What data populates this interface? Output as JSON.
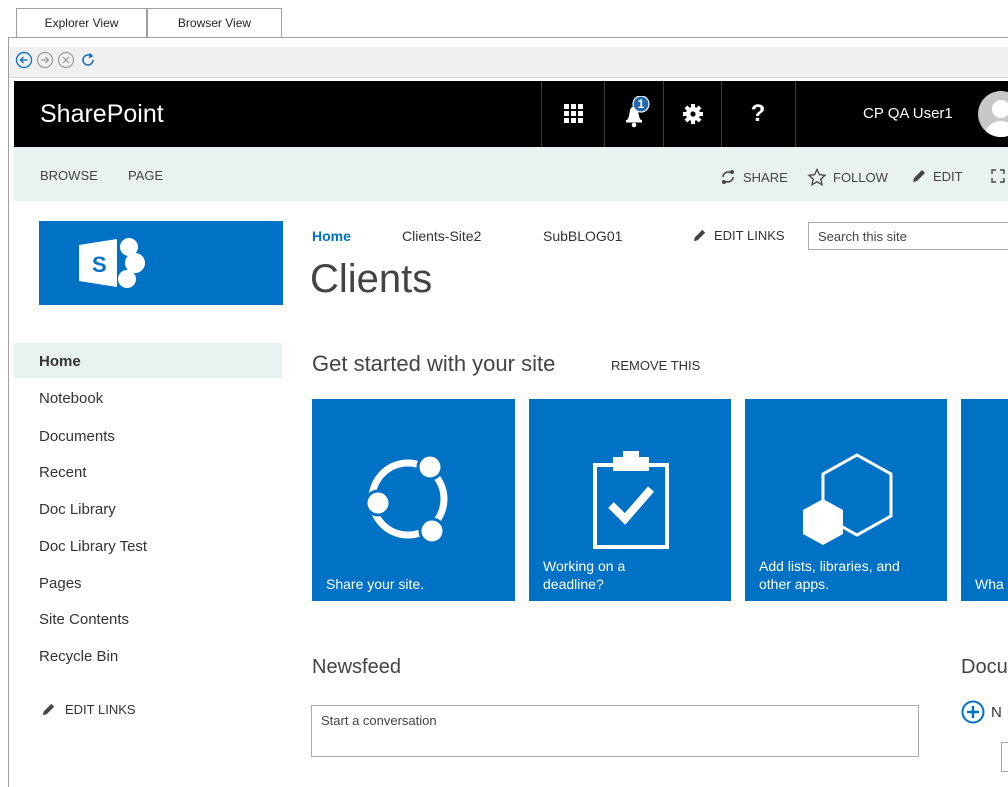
{
  "host_tabs": [
    {
      "label": "Explorer View"
    },
    {
      "label": "Browser View"
    }
  ],
  "suite_bar": {
    "brand": "SharePoint",
    "notification_count": "1",
    "help_symbol": "?",
    "user_name": "CP QA User1"
  },
  "ribbon": {
    "tabs": [
      "BROWSE",
      "PAGE"
    ],
    "actions": {
      "share": "SHARE",
      "follow": "FOLLOW",
      "edit": "EDIT"
    }
  },
  "top_nav": {
    "items": [
      "Home",
      "Clients-Site2",
      "SubBLOG01"
    ],
    "edit_links": "EDIT LINKS",
    "search_placeholder": "Search this site"
  },
  "site_title": "Clients",
  "quick_launch": {
    "items": [
      "Home",
      "Notebook",
      "Documents",
      "Recent",
      "Doc Library",
      "Doc Library Test",
      "Pages",
      "Site Contents",
      "Recycle Bin"
    ],
    "edit_links": "EDIT LINKS"
  },
  "getting_started": {
    "title": "Get started with your site",
    "remove": "REMOVE THIS",
    "tiles": [
      {
        "line1": "Share your site.",
        "line2": ""
      },
      {
        "line1": "Working on a",
        "line2": "deadline?"
      },
      {
        "line1": "Add lists, libraries, and",
        "line2": "other apps."
      },
      {
        "line1": "Wha",
        "line2": ""
      }
    ]
  },
  "newsfeed": {
    "title": "Newsfeed",
    "placeholder": "Start a conversation"
  },
  "documents": {
    "title": "Docu",
    "new_label": "N"
  },
  "colors": {
    "accent": "#0072c6",
    "suite_bar": "#000000",
    "ribbon": "#e8f2f0"
  }
}
